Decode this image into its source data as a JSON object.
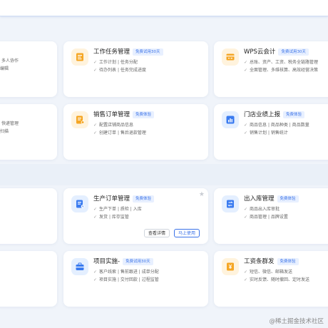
{
  "left_fragments": [
    {
      "lines": [
        "多人协作",
        "编辑"
      ]
    },
    {
      "lines": [
        "快递管理",
        "扫描"
      ]
    }
  ],
  "cards": [
    {
      "id": "work-task",
      "title": "工作任务管理",
      "badge": "免费试用30天",
      "icon": "task-list-icon",
      "lines": [
        "工作计划 | 任务分配",
        "待办列表 | 任务完成进度"
      ]
    },
    {
      "id": "wps-accounting",
      "title": "WPS云会计",
      "badge": "免费试用30天",
      "icon": "accounting-icon",
      "lines": [
        "总账、资产、工资、税务全链路管理",
        "全面管理、多维核算、高效经营决策"
      ]
    },
    {
      "id": "sales-order",
      "title": "销售订单管理",
      "badge": "免费体验",
      "icon": "sales-order-icon",
      "lines": [
        "配置店铺商品信息",
        "创建订单 | 售后退款管理"
      ]
    },
    {
      "id": "store-report",
      "title": "门店业绩上报",
      "badge": "免费体验",
      "icon": "store-report-icon",
      "lines": [
        "商品信息 | 商品种类 | 商品数量",
        "销售计划 | 销售统计"
      ]
    },
    {
      "id": "production-order",
      "title": "生产订单管理",
      "badge": "免费体验",
      "icon": "production-icon",
      "lines": [
        "生产下单 | 质检 | 入库",
        "发货 | 库存监管"
      ],
      "view_label": "查看详情",
      "use_label": "马上使用"
    },
    {
      "id": "warehouse",
      "title": "出入库管理",
      "badge": "免费体验",
      "icon": "warehouse-icon",
      "lines": [
        "商品出入库审批",
        "商品管理 | 品牌设置"
      ]
    },
    {
      "id": "project-impl",
      "title": "项目实施-",
      "badge": "免费试用30天",
      "icon": "project-icon",
      "lines": [
        "客户线索 | 售前跟进 | 成单分配",
        "项目实施 | 交付回款 | 过程监管"
      ]
    },
    {
      "id": "payslip",
      "title": "工资条群发",
      "badge": "免费体验",
      "icon": "payslip-icon",
      "lines": [
        "短信、微信、邮箱发送",
        "实时反馈、随时撤回、定时发送"
      ]
    }
  ],
  "watermark": "@稀土掘金技术社区",
  "colors": {
    "accent": "#3a72e8",
    "orange": "#f5a623",
    "blue": "#3a7bf0"
  }
}
